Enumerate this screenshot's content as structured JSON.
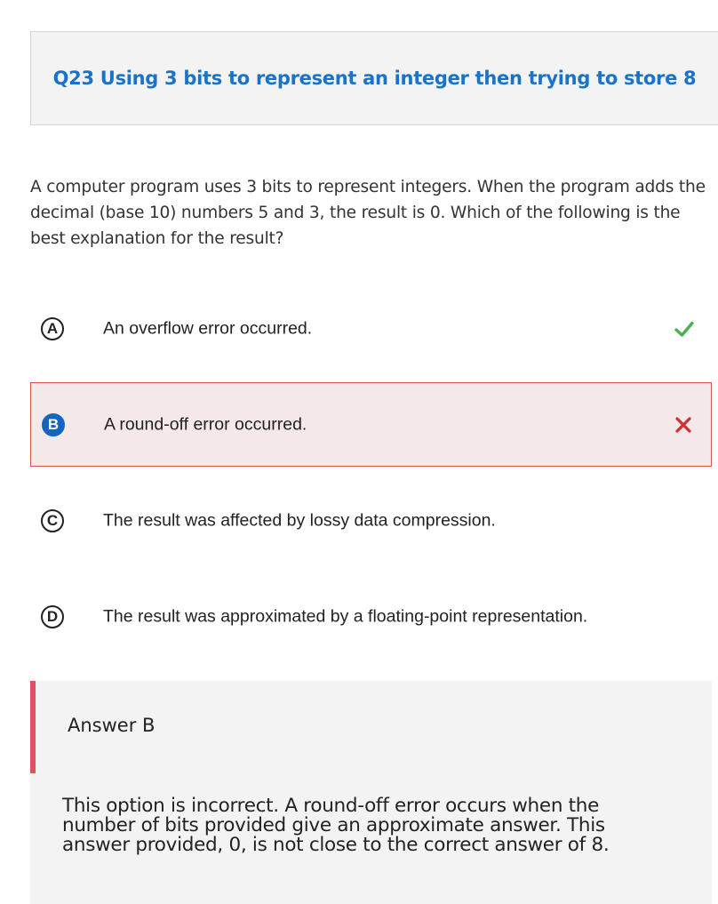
{
  "question_title": "Q23 Using 3 bits to represent an integer then trying to store 8",
  "question_text": "A computer program uses 3 bits to represent integers. When the program adds the decimal (base 10) numbers 5 and 3, the result is 0. Which of the following is the best explanation for the result?",
  "options": [
    {
      "letter": "A",
      "text": "An overflow error occurred.",
      "status": "correct",
      "status_icon": "checkmark-icon"
    },
    {
      "letter": "B",
      "text": "A round-off error occurred.",
      "status": "selected-incorrect",
      "status_icon": "x-icon"
    },
    {
      "letter": "C",
      "text": "The result was affected by lossy data compression.",
      "status": "none"
    },
    {
      "letter": "D",
      "text": "The result was approximated by a floating-point representation.",
      "status": "none"
    }
  ],
  "explanation": {
    "title": "Answer B",
    "body": "This option is incorrect. A round-off error occurs when the number of bits provided give an approximate answer. This answer provided, 0, is not close to the correct answer of 8."
  },
  "colors": {
    "title_blue": "#1a73c8",
    "selected_letter": "#1565c0",
    "correct_green": "#4caf50",
    "incorrect_red": "#d32f2f",
    "wrong_bg": "#f5e8e8",
    "wrong_border": "#d9534f",
    "explanation_bar": "#e0525f",
    "panel_gray": "#f3f3f3"
  }
}
